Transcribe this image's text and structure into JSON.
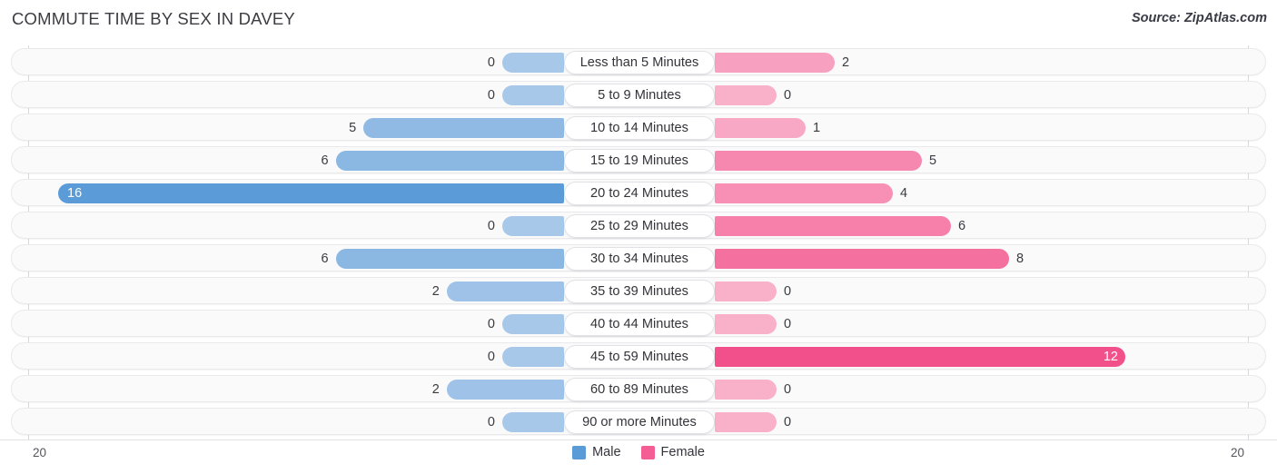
{
  "header": {
    "title": "COMMUTE TIME BY SEX IN DAVEY",
    "source": "Source: ZipAtlas.com"
  },
  "axis": {
    "left_tick": "20",
    "right_tick": "20",
    "max": 20
  },
  "legend": {
    "items": [
      {
        "label": "Male",
        "color": "#5b9bd8"
      },
      {
        "label": "Female",
        "color": "#f45e94"
      }
    ]
  },
  "colors": {
    "male_min": "#a8c8ea",
    "male_max": "#5b9bd8",
    "female_min": "#f9b0c9",
    "female_max": "#f2508a",
    "row_bg": "#fafafa",
    "row_border": "#e9e9ec",
    "text": "#3a3a42"
  },
  "chart_data": {
    "type": "bar",
    "title": "COMMUTE TIME BY SEX IN DAVEY",
    "subtitle": "Source: ZipAtlas.com",
    "orientation": "horizontal-diverging",
    "xlabel": "",
    "ylabel": "",
    "xlim": [
      20,
      20
    ],
    "grid": false,
    "legend_position": "bottom-center",
    "categories": [
      "Less than 5 Minutes",
      "5 to 9 Minutes",
      "10 to 14 Minutes",
      "15 to 19 Minutes",
      "20 to 24 Minutes",
      "25 to 29 Minutes",
      "30 to 34 Minutes",
      "35 to 39 Minutes",
      "40 to 44 Minutes",
      "45 to 59 Minutes",
      "60 to 89 Minutes",
      "90 or more Minutes"
    ],
    "series": [
      {
        "name": "Male",
        "values": [
          0,
          0,
          5,
          6,
          16,
          0,
          6,
          2,
          0,
          0,
          2,
          0
        ]
      },
      {
        "name": "Female",
        "values": [
          2,
          0,
          1,
          5,
          4,
          6,
          8,
          0,
          0,
          12,
          0,
          0
        ]
      }
    ]
  },
  "rows": [
    {
      "label": "Less than 5 Minutes",
      "male": "0",
      "female": "2"
    },
    {
      "label": "5 to 9 Minutes",
      "male": "0",
      "female": "0"
    },
    {
      "label": "10 to 14 Minutes",
      "male": "5",
      "female": "1"
    },
    {
      "label": "15 to 19 Minutes",
      "male": "6",
      "female": "5"
    },
    {
      "label": "20 to 24 Minutes",
      "male": "16",
      "female": "4"
    },
    {
      "label": "25 to 29 Minutes",
      "male": "0",
      "female": "6"
    },
    {
      "label": "30 to 34 Minutes",
      "male": "6",
      "female": "8"
    },
    {
      "label": "35 to 39 Minutes",
      "male": "2",
      "female": "0"
    },
    {
      "label": "40 to 44 Minutes",
      "male": "0",
      "female": "0"
    },
    {
      "label": "45 to 59 Minutes",
      "male": "0",
      "female": "12"
    },
    {
      "label": "60 to 89 Minutes",
      "male": "2",
      "female": "0"
    },
    {
      "label": "90 or more Minutes",
      "male": "0",
      "female": "0"
    }
  ]
}
